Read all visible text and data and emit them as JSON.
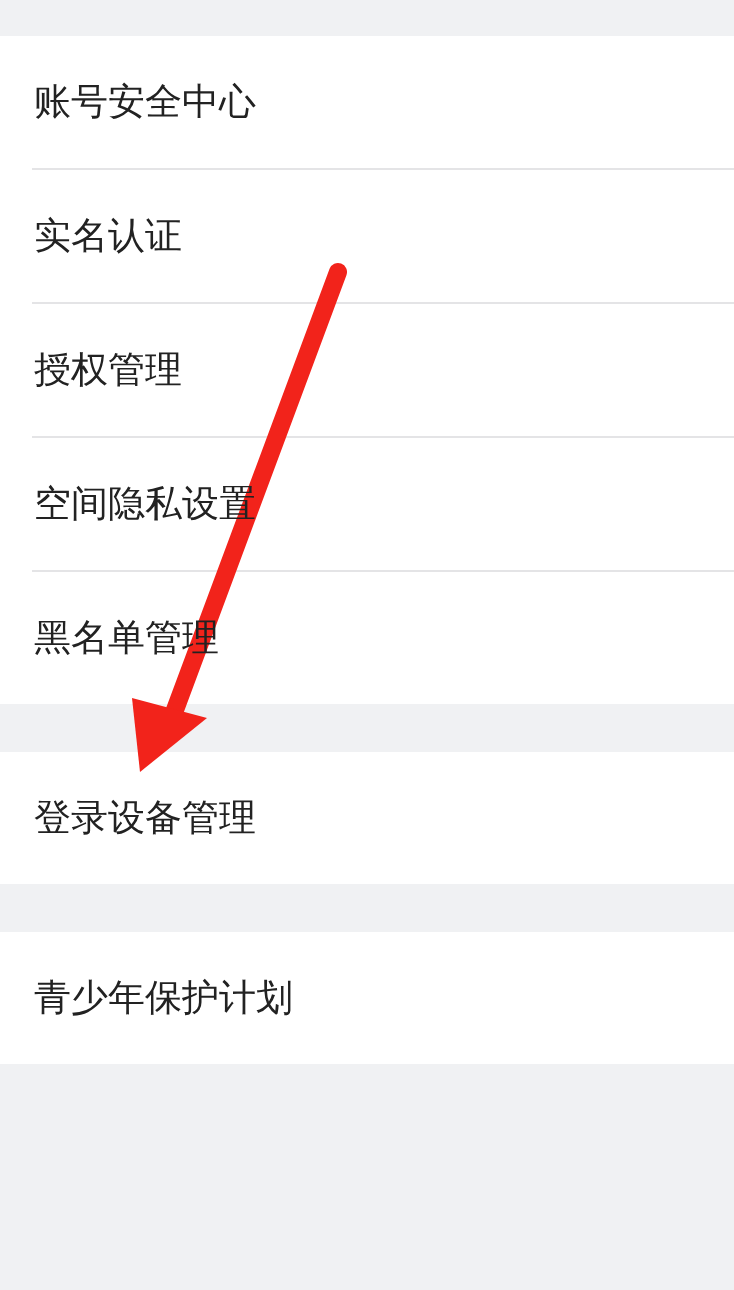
{
  "groups": [
    {
      "items": [
        {
          "label": "账号安全中心"
        },
        {
          "label": "实名认证"
        },
        {
          "label": "授权管理"
        },
        {
          "label": "空间隐私设置"
        },
        {
          "label": "黑名单管理"
        }
      ]
    },
    {
      "items": [
        {
          "label": "登录设备管理"
        }
      ]
    },
    {
      "items": [
        {
          "label": "青少年保护计划"
        }
      ]
    }
  ]
}
